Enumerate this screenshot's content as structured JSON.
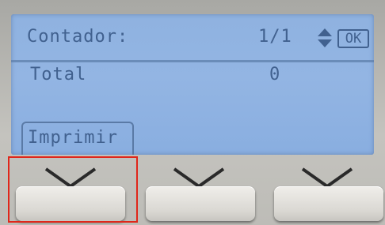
{
  "screen": {
    "title": "Contador:",
    "page_indicator": "1/1",
    "ok_label": "OK",
    "rows": [
      {
        "label": "Total",
        "value": "0"
      }
    ],
    "softkey_label": "Imprimir"
  },
  "icons": {
    "scroll": "up-down-arrows-icon",
    "softkey_indicator": "chevron-down-icon"
  },
  "colors": {
    "lcd_background": "#93b5e3",
    "lcd_text": "#41618f",
    "highlight": "#e0261a"
  }
}
